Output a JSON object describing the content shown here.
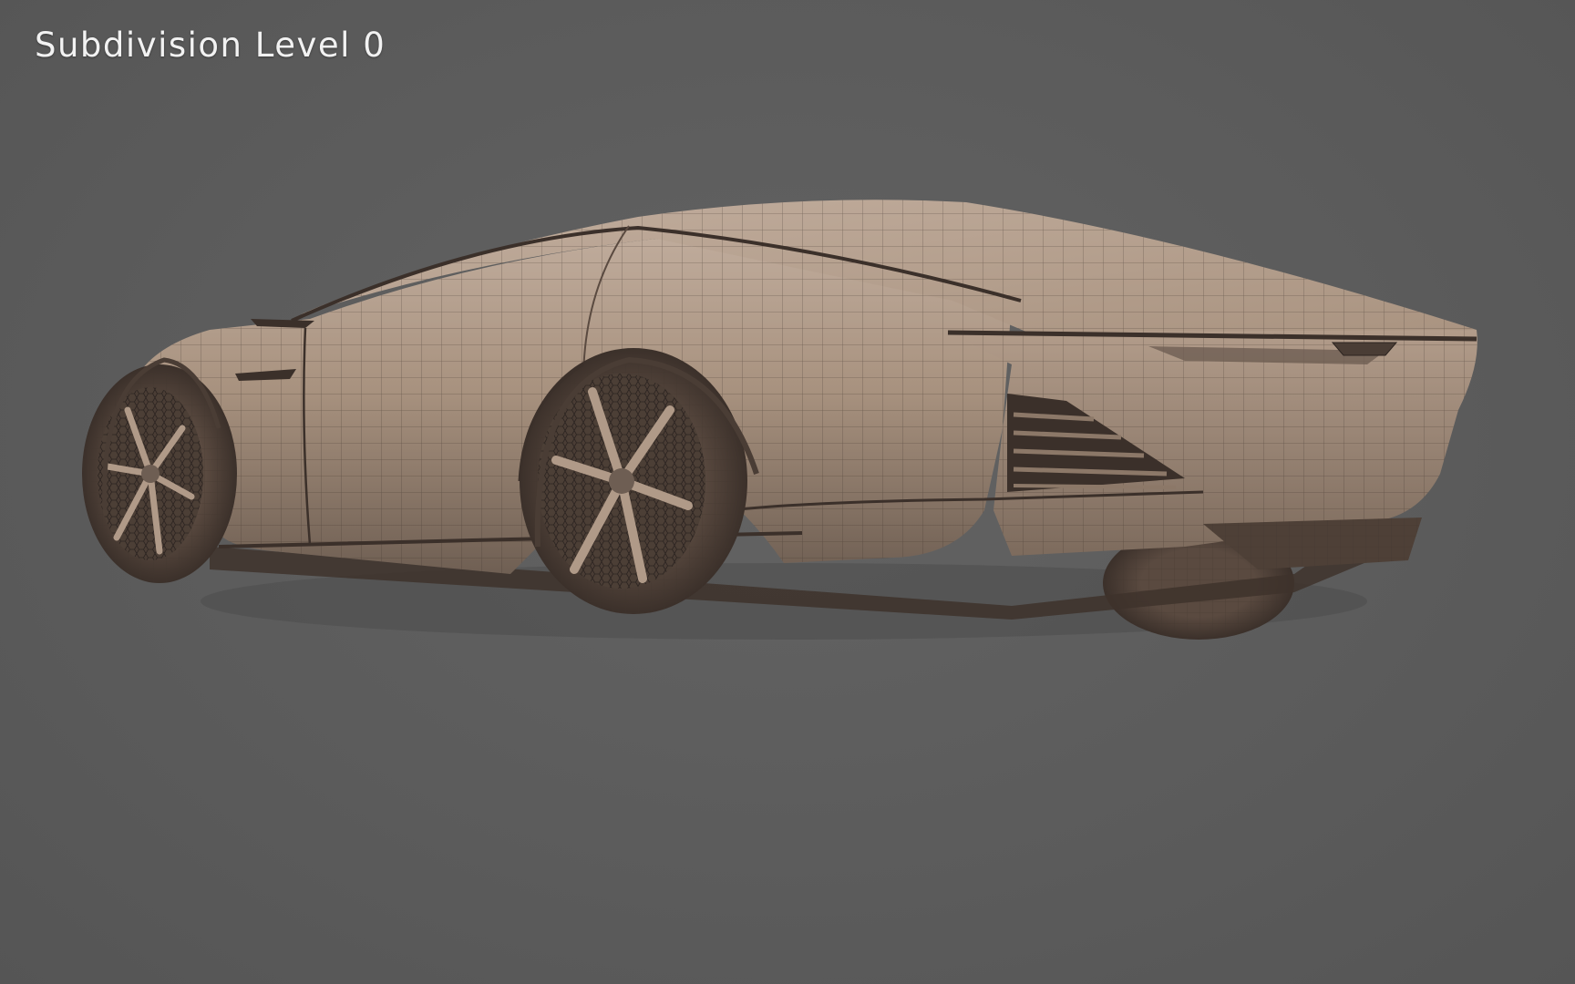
{
  "viewport": {
    "label": "Subdivision Level 0"
  },
  "colors": {
    "background": "#5d5d5d",
    "clay": "#a08b7c",
    "clay_light": "#b8a494",
    "clay_dark": "#6e5e53",
    "wire": "#3e332c",
    "label_text": "#f2f2f2"
  }
}
